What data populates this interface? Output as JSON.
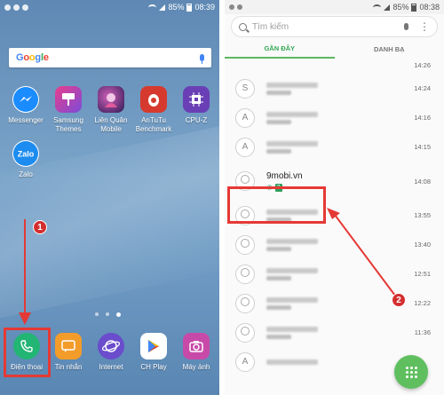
{
  "status_left": {
    "battery_pct": "85%",
    "time": "08:39"
  },
  "status_right": {
    "battery_pct": "85%",
    "time": "08:38"
  },
  "google_search": {
    "logo": [
      "G",
      "o",
      "o",
      "g",
      "l",
      "e"
    ]
  },
  "apps_row1": [
    {
      "label": "Messenger",
      "icon": "messenger-icon"
    },
    {
      "label": "Samsung Themes",
      "icon": "themes-icon"
    },
    {
      "label": "Liên Quân Mobile",
      "icon": "game-icon"
    },
    {
      "label": "AnTuTu Benchmark",
      "icon": "antutu-icon"
    },
    {
      "label": "CPU-Z",
      "icon": "cpu-icon"
    }
  ],
  "apps_row2": [
    {
      "label": "Zalo",
      "icon": "zalo-icon"
    }
  ],
  "dock": [
    {
      "label": "Điện thoại",
      "icon": "phone-icon"
    },
    {
      "label": "Tin nhắn",
      "icon": "message-icon"
    },
    {
      "label": "Internet",
      "icon": "globe-icon"
    },
    {
      "label": "CH Play",
      "icon": "play-store-icon"
    },
    {
      "label": "Máy ảnh",
      "icon": "camera-icon"
    }
  ],
  "step_badges": {
    "one": "1",
    "two": "2"
  },
  "phone_app": {
    "search_placeholder": "Tìm kiếm",
    "tabs": [
      "GẦN ĐÂY",
      "DANH BẠ"
    ],
    "rows": [
      {
        "avatar": "",
        "time": "14:26"
      },
      {
        "avatar": "S",
        "time": "14:24"
      },
      {
        "avatar": "A",
        "time": "14:16"
      },
      {
        "avatar": "A",
        "time": "14:15"
      },
      {
        "avatar": "",
        "name": "9mobi.vn",
        "sim": "2",
        "time": "14:08",
        "highlight": true
      },
      {
        "avatar": "",
        "time": "13:55"
      },
      {
        "avatar": "",
        "time": "13:40"
      },
      {
        "avatar": "",
        "time": "12:51"
      },
      {
        "avatar": "",
        "time": "12:22"
      },
      {
        "avatar": "",
        "time": "11:36"
      },
      {
        "avatar": "A",
        "time": ""
      }
    ]
  },
  "colors": {
    "accent_red": "#e53935",
    "tab_green": "#33a853",
    "fab_green": "#5fbf5f"
  }
}
